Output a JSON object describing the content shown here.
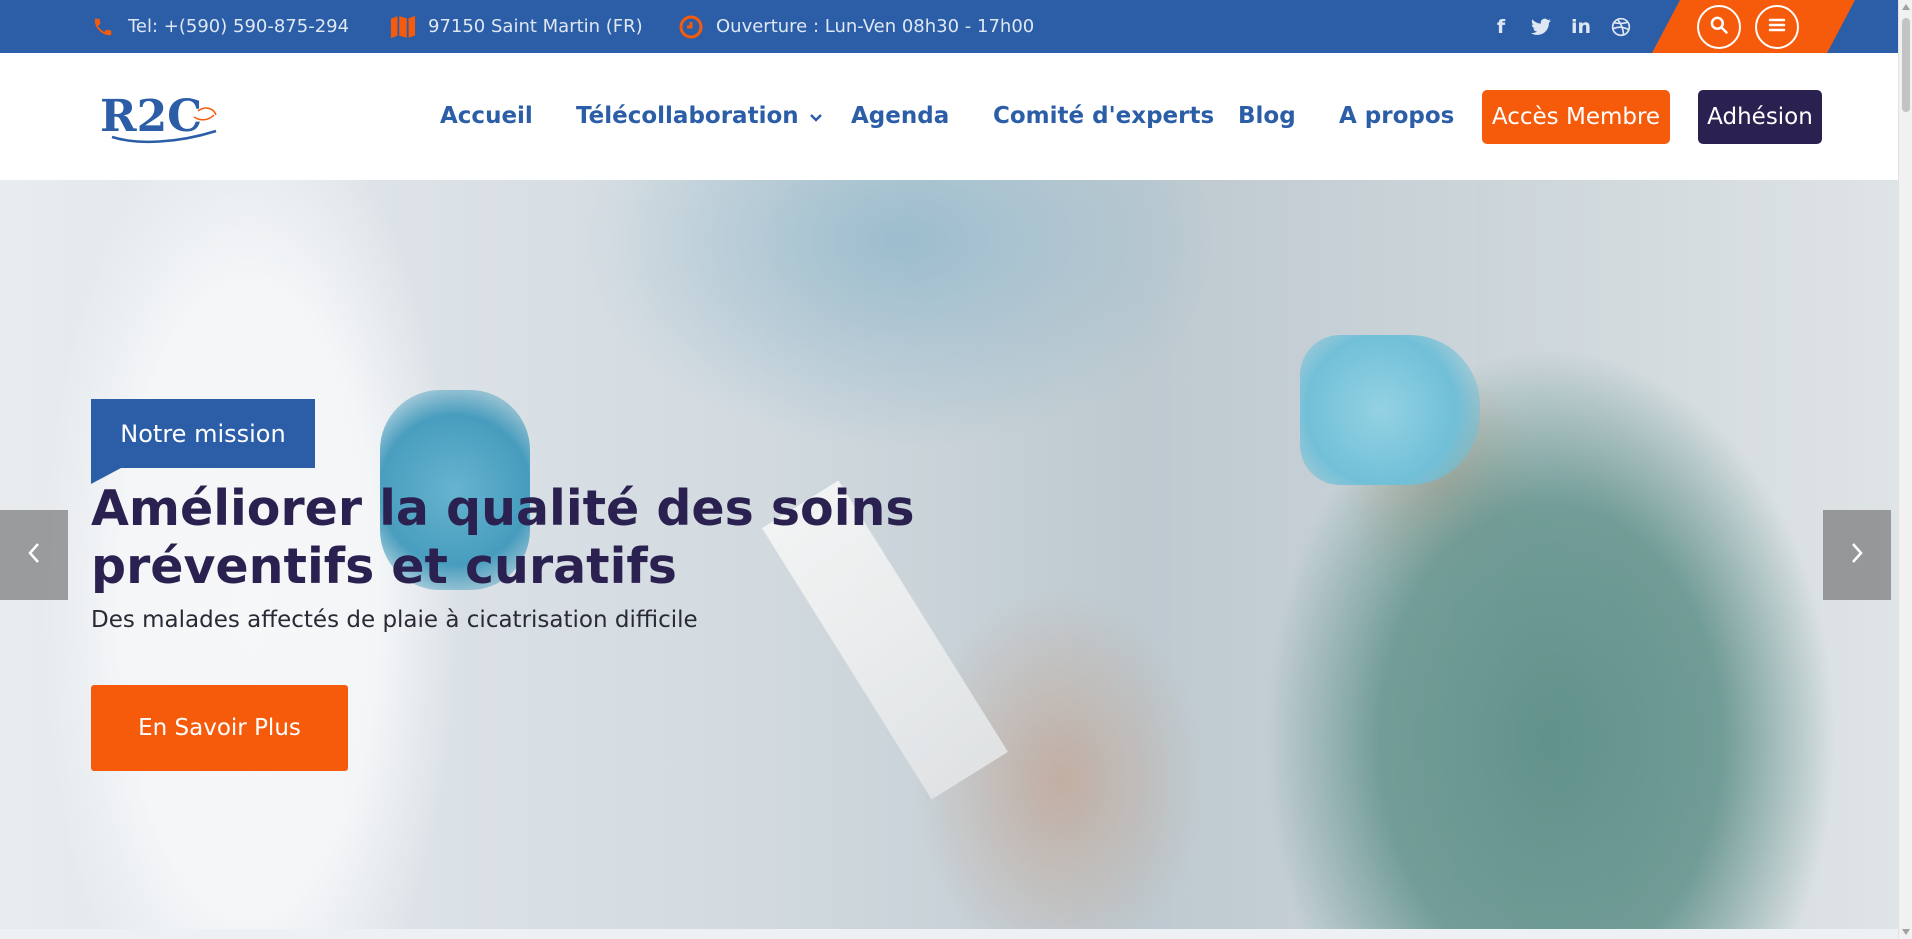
{
  "topbar": {
    "phone": "Tel: +(590) 590-875-294",
    "address": "97150 Saint Martin (FR)",
    "hours": "Ouverture : Lun-Ven 08h30 - 17h00",
    "social": {
      "facebook": "f",
      "linkedin": "in"
    },
    "colors": {
      "bar": "#2b5ea7",
      "accent": "#f65b0c"
    },
    "icons": [
      "phone-icon",
      "map-icon",
      "clock-icon",
      "facebook-icon",
      "twitter-icon",
      "linkedin-icon",
      "dribbble-icon",
      "search-icon",
      "menu-icon"
    ]
  },
  "header": {
    "logo_text": "R2C",
    "nav": {
      "accueil": "Accueil",
      "telecollaboration": "Télécollaboration",
      "agenda": "Agenda",
      "comite": "Comité d'experts",
      "blog": "Blog",
      "apropos": "A propos"
    },
    "member_button": "Accès Membre",
    "adhesion_button": "Adhésion",
    "colors": {
      "nav": "#2b5ea7",
      "member": "#f65b0c",
      "adhesion": "#2b2150"
    }
  },
  "hero": {
    "badge": "Notre mission",
    "title": "Améliorer la qualité des soins préventifs et curatifs",
    "subtitle": "Des malades affectés de plaie à cicatrisation difficile",
    "button": "En Savoir Plus",
    "colors": {
      "title": "#2b2150",
      "button": "#f65b0c"
    }
  }
}
